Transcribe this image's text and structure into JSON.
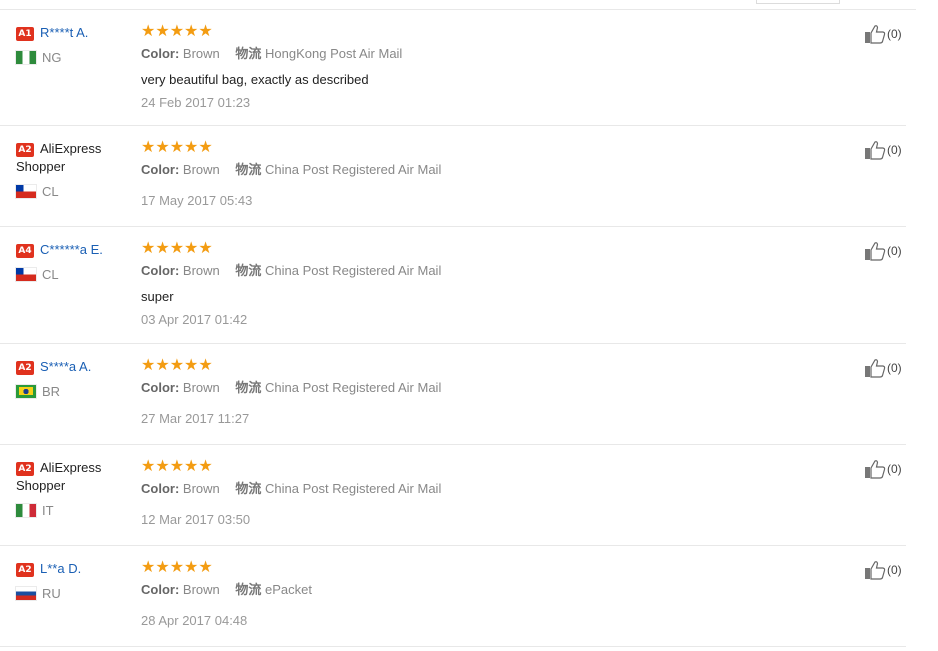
{
  "reviews": [
    {
      "level": "A1",
      "name": "R****t A.",
      "name_is_link": true,
      "country": "NG",
      "flag": "ng",
      "stars": "★★★★★",
      "rating": 5,
      "color_label": "Color:",
      "color_value": "Brown",
      "shipping_label": "物流",
      "shipping_value": "HongKong Post Air Mail",
      "text": "very beautiful bag, exactly as described",
      "date": "24 Feb 2017 01:23",
      "helpful_count": "(0)"
    },
    {
      "level": "A2",
      "name": "AliExpress Shopper",
      "name_is_link": false,
      "country": "CL",
      "flag": "cl",
      "stars": "★★★★★",
      "rating": 5,
      "color_label": "Color:",
      "color_value": "Brown",
      "shipping_label": "物流",
      "shipping_value": "China Post Registered Air Mail",
      "text": "",
      "date": "17 May 2017 05:43",
      "helpful_count": "(0)"
    },
    {
      "level": "A4",
      "name": "C******a E.",
      "name_is_link": true,
      "country": "CL",
      "flag": "cl",
      "stars": "★★★★★",
      "rating": 5,
      "color_label": "Color:",
      "color_value": "Brown",
      "shipping_label": "物流",
      "shipping_value": "China Post Registered Air Mail",
      "text": "super",
      "date": "03 Apr 2017 01:42",
      "helpful_count": "(0)"
    },
    {
      "level": "A2",
      "name": "S****a A.",
      "name_is_link": true,
      "country": "BR",
      "flag": "br",
      "stars": "★★★★★",
      "rating": 5,
      "color_label": "Color:",
      "color_value": "Brown",
      "shipping_label": "物流",
      "shipping_value": "China Post Registered Air Mail",
      "text": "",
      "date": "27 Mar 2017 11:27",
      "helpful_count": "(0)"
    },
    {
      "level": "A2",
      "name": "AliExpress Shopper",
      "name_is_link": false,
      "country": "IT",
      "flag": "it",
      "stars": "★★★★★",
      "rating": 5,
      "color_label": "Color:",
      "color_value": "Brown",
      "shipping_label": "物流",
      "shipping_value": "China Post Registered Air Mail",
      "text": "",
      "date": "12 Mar 2017 03:50",
      "helpful_count": "(0)"
    },
    {
      "level": "A2",
      "name": "L**a D.",
      "name_is_link": true,
      "country": "RU",
      "flag": "ru",
      "stars": "★★★★★",
      "rating": 5,
      "color_label": "Color:",
      "color_value": "Brown",
      "shipping_label": "物流",
      "shipping_value": "ePacket",
      "text": "",
      "date": "28 Apr 2017 04:48",
      "helpful_count": "(0)"
    }
  ],
  "colors": {
    "badge": "#e0321e",
    "link": "#1a5fb4",
    "star": "#f39c12",
    "muted": "#888888"
  },
  "icons": {
    "helpful": "thumbs-up-icon",
    "rating": "star-icon"
  }
}
